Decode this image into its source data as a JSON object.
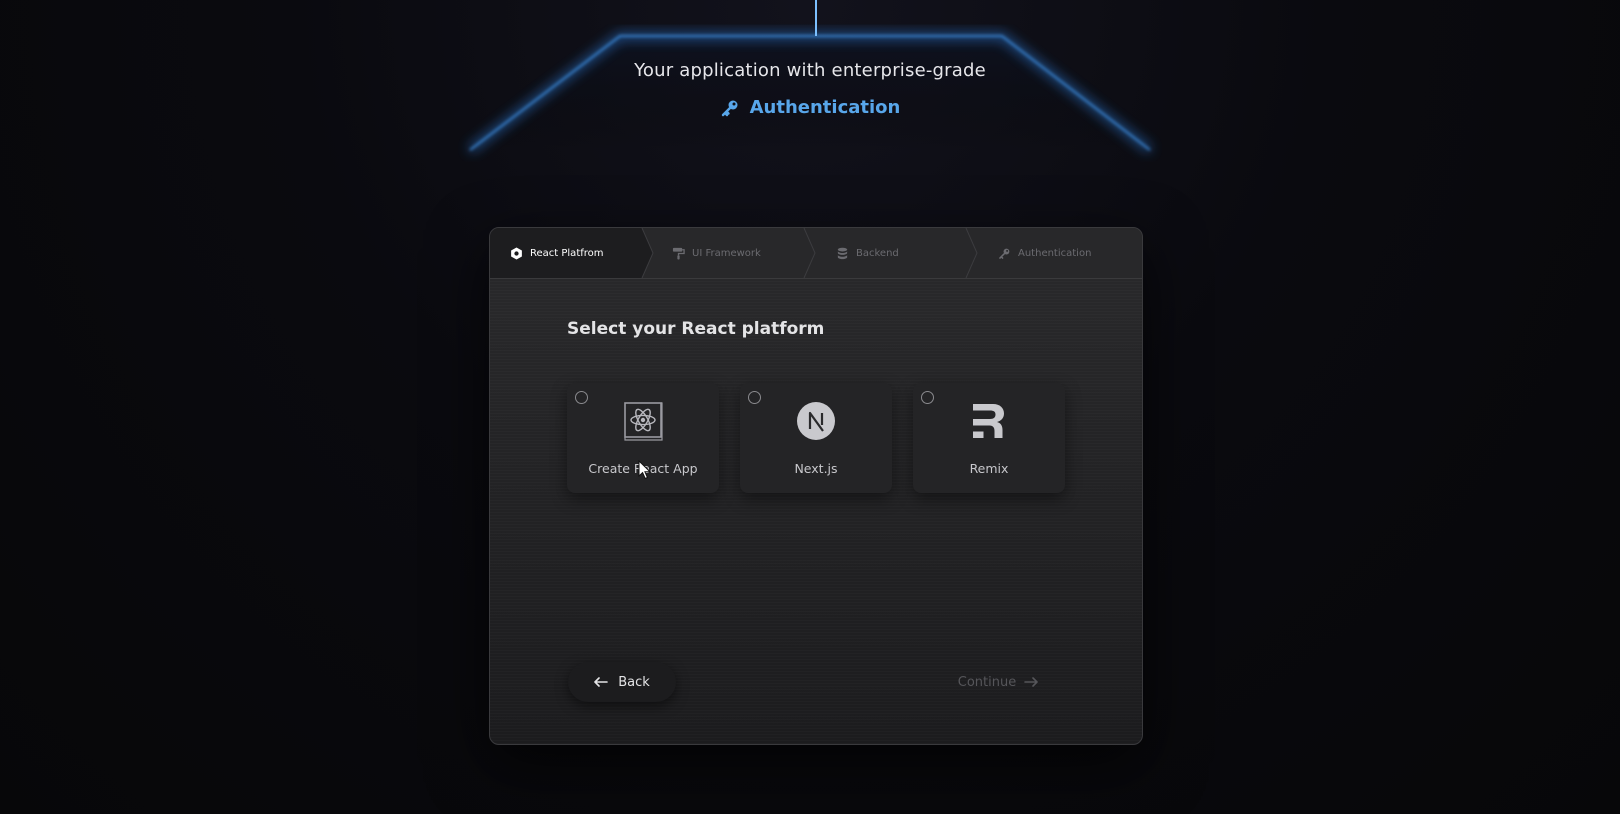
{
  "header": {
    "subtitle": "Your application with enterprise-grade",
    "brand_label": "Authentication",
    "accent_color": "#58a6ea"
  },
  "steps": [
    {
      "label": "React Platfrom",
      "icon": "hexagon-icon",
      "active": true
    },
    {
      "label": "UI Framework",
      "icon": "paint-roller-icon",
      "active": false
    },
    {
      "label": "Backend",
      "icon": "database-icon",
      "active": false
    },
    {
      "label": "Authentication",
      "icon": "key-icon",
      "active": false
    }
  ],
  "main": {
    "title": "Select your React platform",
    "options": [
      {
        "label": "Create React App",
        "icon": "react-atom-icon",
        "selected": false
      },
      {
        "label": "Next.js",
        "icon": "nextjs-icon",
        "selected": false
      },
      {
        "label": "Remix",
        "icon": "remix-icon",
        "selected": false
      }
    ]
  },
  "footer": {
    "back_label": "Back",
    "continue_label": "Continue"
  }
}
